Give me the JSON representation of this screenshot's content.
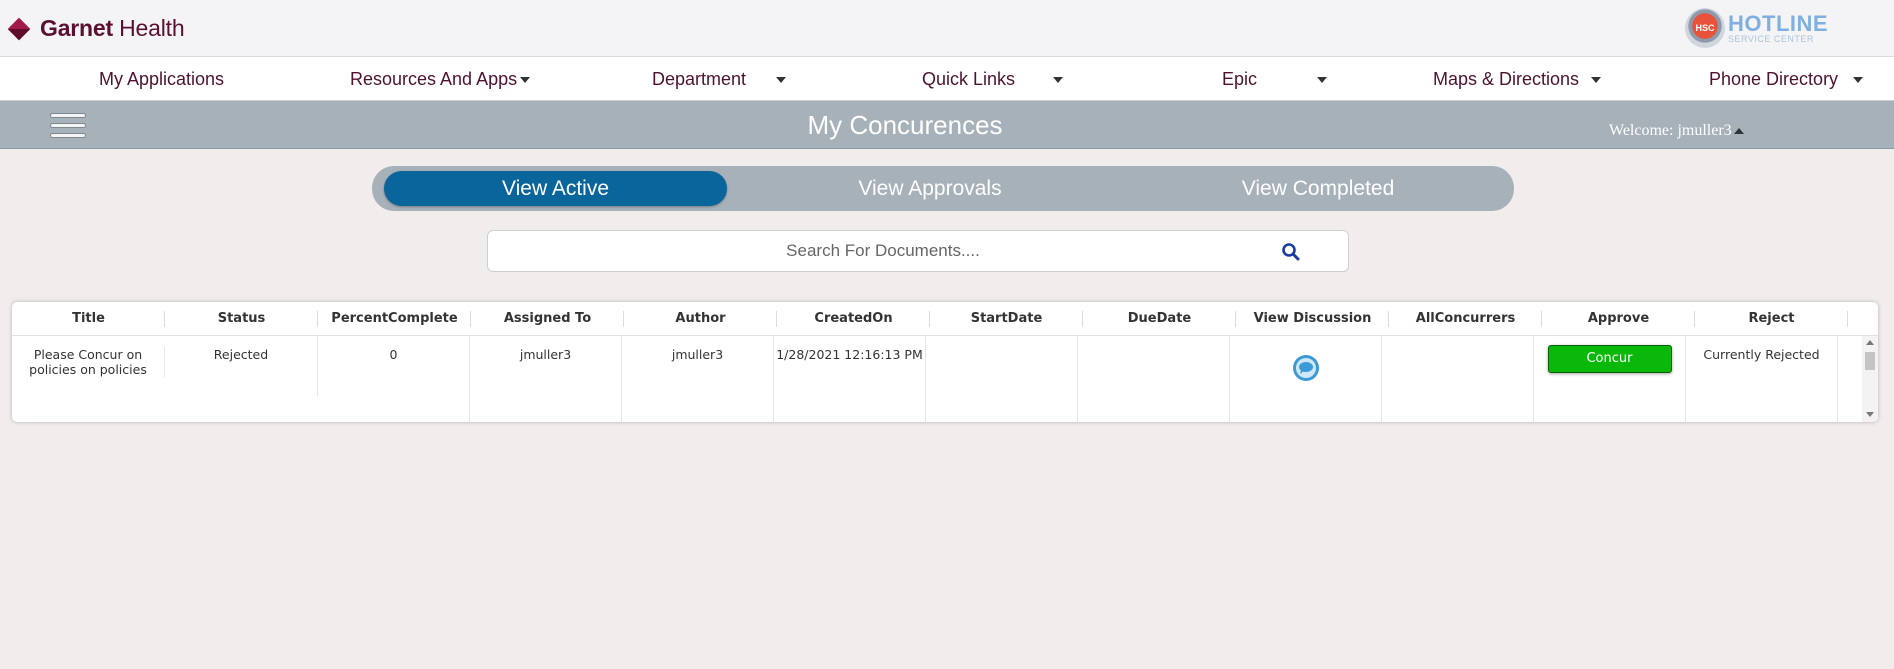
{
  "brand": {
    "name_bold": "Garnet",
    "name_rest": " Health"
  },
  "hotline": {
    "badge": "HSC",
    "title": "HOTLINE",
    "subtitle": "SERVICE CENTER"
  },
  "nav": {
    "items": [
      {
        "label": "My Applications"
      },
      {
        "label": "Resources And Apps"
      },
      {
        "label": "Department"
      },
      {
        "label": "Quick Links"
      },
      {
        "label": "Epic"
      },
      {
        "label": "Maps & Directions"
      },
      {
        "label": "Phone Directory"
      }
    ]
  },
  "titlebar": {
    "title": "My Concurences",
    "welcome": "Welcome: jmuller3"
  },
  "tabs": [
    {
      "label": "View Active",
      "active": true
    },
    {
      "label": "View Approvals",
      "active": false
    },
    {
      "label": "View Completed",
      "active": false
    }
  ],
  "search": {
    "placeholder": "Search For Documents....",
    "value": ""
  },
  "grid": {
    "columns": [
      "Title",
      "Status",
      "PercentComplete",
      "Assigned To",
      "Author",
      "CreatedOn",
      "StartDate",
      "DueDate",
      "View Discussion",
      "AllConcurrers",
      "Approve",
      "Reject"
    ],
    "rows": [
      {
        "title": "Please Concur on policies on policies",
        "status": "Rejected",
        "percent": "0",
        "assigned_to": "jmuller3",
        "author": "jmuller3",
        "created_on": "1/28/2021 12:16:13 PM",
        "start_date": "",
        "due_date": "",
        "all_concurrers": "",
        "approve_label": "Concur",
        "reject": "Currently Rejected"
      }
    ]
  },
  "colors": {
    "brand": "#5a1030",
    "nav_text": "#4e1231",
    "titlebar": "#a7b1ba",
    "active_tab": "#09659a",
    "concur": "#0ab80a"
  },
  "icons": [
    "garnet-diamond-logo",
    "hamburger-menu-icon",
    "search-icon",
    "chat-bubble-icon",
    "caret-down-icon"
  ]
}
